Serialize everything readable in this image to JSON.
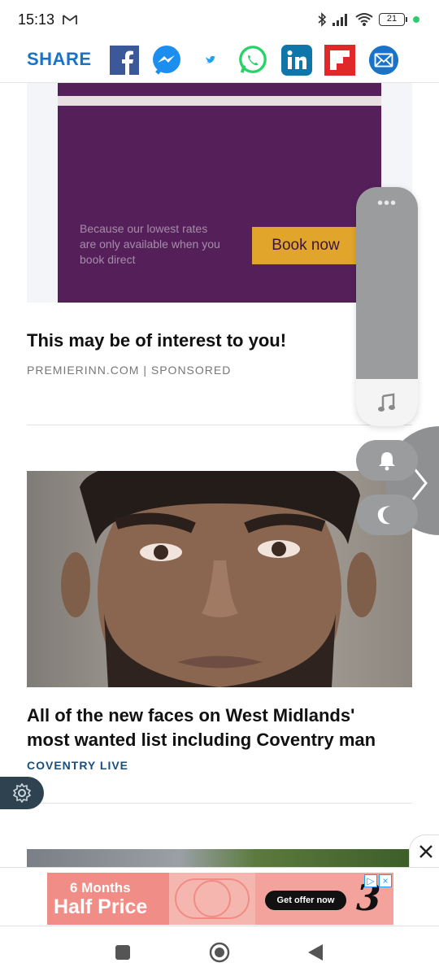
{
  "status_bar": {
    "time": "15:13",
    "battery": "21"
  },
  "share_bar": {
    "label": "SHARE",
    "icons": [
      "facebook-icon",
      "messenger-icon",
      "twitter-icon",
      "whatsapp-icon",
      "linkedin-icon",
      "flipboard-icon",
      "email-icon"
    ]
  },
  "ad": {
    "body": "Because our lowest rates are only available when you book direct",
    "cta": "Book now",
    "headline": "This may be of interest to you!",
    "source": "PREMIERINN.COM",
    "separator": "|",
    "sponsored": "SPONSORED"
  },
  "article": {
    "headline": "All of the new faces on West Midlands' most wanted list including Coventry man",
    "source": "COVENTRY LIVE"
  },
  "banner": {
    "line1": "6 Months",
    "line2": "Half Price",
    "cta": "Get offer now",
    "brand_glyph": "3"
  },
  "colors": {
    "share_blue": "#1a73c7",
    "premier_purple": "#55205a",
    "premier_gold": "#e2a52c",
    "source_blue": "#1a4f7a"
  }
}
